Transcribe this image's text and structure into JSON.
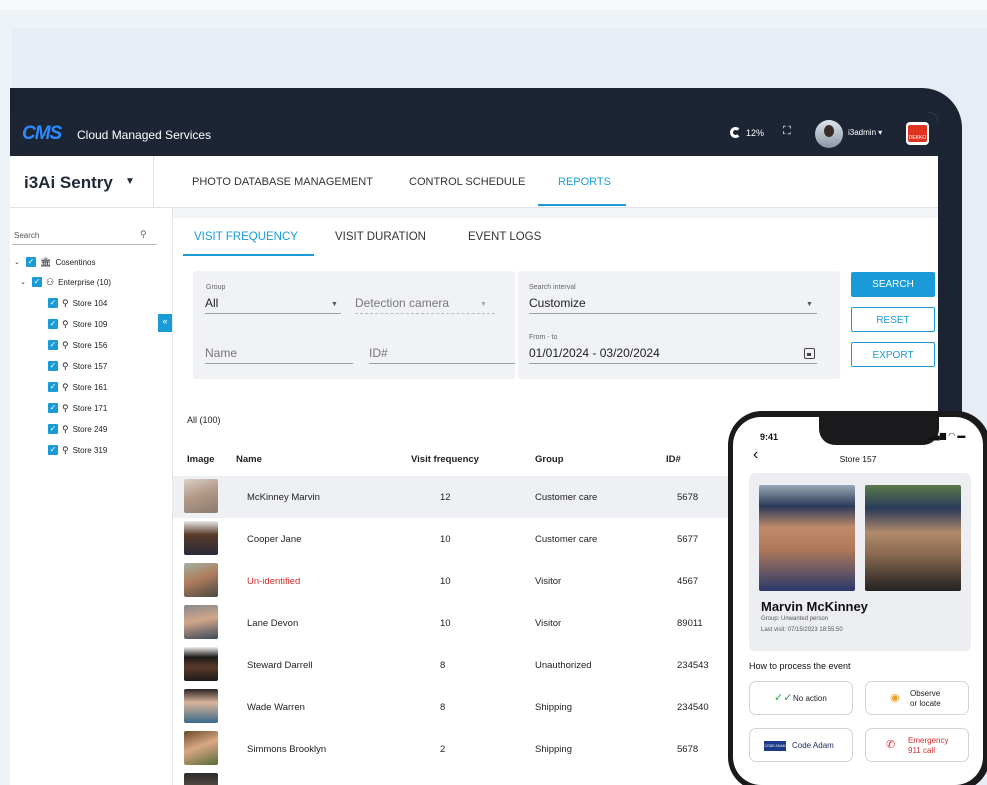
{
  "header": {
    "logo": "CMS",
    "title": "Cloud Managed Services",
    "cpu": "12%",
    "username": "i3admin",
    "partner_logo": "DEKKO"
  },
  "subheader": {
    "brand": "i3Ai Sentry",
    "nav": [
      {
        "label": "PHOTO DATABASE MANAGEMENT",
        "active": false
      },
      {
        "label": "CONTROL SCHEDULE",
        "active": false
      },
      {
        "label": "REPORTS",
        "active": true
      }
    ]
  },
  "sidebar": {
    "search_label": "Search",
    "collapse_glyph": "«",
    "tree": [
      {
        "label": "Cosentinos",
        "icon": "bank-icon",
        "level": 0
      },
      {
        "label": "Enterprise (10)",
        "icon": "enterprise-icon",
        "level": 1
      },
      {
        "label": "Store 104",
        "icon": "store-pin-icon",
        "level": 2
      },
      {
        "label": "Store 109",
        "icon": "store-pin-icon",
        "level": 2
      },
      {
        "label": "Store 156",
        "icon": "store-pin-icon",
        "level": 2
      },
      {
        "label": "Store 157",
        "icon": "store-pin-icon",
        "level": 2
      },
      {
        "label": "Store 161",
        "icon": "store-pin-icon",
        "level": 2
      },
      {
        "label": "Store 171",
        "icon": "store-pin-icon",
        "level": 2
      },
      {
        "label": "Store 249",
        "icon": "store-pin-icon",
        "level": 2
      },
      {
        "label": "Store 319",
        "icon": "store-pin-icon",
        "level": 2
      }
    ]
  },
  "report_tabs": [
    {
      "label": "VISIT FREQUENCY",
      "active": true
    },
    {
      "label": "VISIT DURATION",
      "active": false
    },
    {
      "label": "EVENT LOGS",
      "active": false
    }
  ],
  "filters": {
    "group_label": "Group",
    "group_value": "All",
    "camera_placeholder": "Detection camera",
    "name_placeholder": "Name",
    "id_placeholder": "ID#",
    "interval_label": "Search interval",
    "interval_value": "Customize",
    "range_label": "From - to",
    "range_value": "01/01/2024 - 03/20/2024",
    "search_button": "SEARCH",
    "reset_button": "RESET",
    "export_button": "EXPORT"
  },
  "table": {
    "count": "All (100)",
    "columns": [
      "Image",
      "Name",
      "Visit frequency",
      "Group",
      "ID#"
    ],
    "rows": [
      {
        "name": "McKinney Marvin",
        "freq": "12",
        "group": "Customer care",
        "id": "5678",
        "selected": true,
        "unidentified": false
      },
      {
        "name": "Cooper Jane",
        "freq": "10",
        "group": "Customer care",
        "id": "5677",
        "selected": false,
        "unidentified": false
      },
      {
        "name": "Un-identified",
        "freq": "10",
        "group": "Visitor",
        "id": "4567",
        "selected": false,
        "unidentified": true
      },
      {
        "name": "Lane Devon",
        "freq": "10",
        "group": "Visitor",
        "id": "89011",
        "selected": false,
        "unidentified": false
      },
      {
        "name": "Steward Darrell",
        "freq": "8",
        "group": "Unauthorized",
        "id": "234543",
        "selected": false,
        "unidentified": false
      },
      {
        "name": "Wade Warren",
        "freq": "8",
        "group": "Shipping",
        "id": "234540",
        "selected": false,
        "unidentified": false
      },
      {
        "name": "Simmons Brooklyn",
        "freq": "2",
        "group": "Shipping",
        "id": "5678",
        "selected": false,
        "unidentified": false
      }
    ]
  },
  "phone": {
    "time": "9:41",
    "title": "Store 157",
    "person_name": "Marvin McKinney",
    "group_line": "Group: Unwanted person",
    "last_visit": "Last visit: 07/15/2023 18:55:50",
    "section": "How to process the event",
    "actions": {
      "no_action": "No action",
      "observe_1": "Observe",
      "observe_2": "or locate",
      "code_adam": "Code Adam",
      "code_adam_badge": "CODE ADAM",
      "emergency_1": "Emergency",
      "emergency_2": "911 call"
    }
  },
  "colors": {
    "accent": "#1a9bd7",
    "header_bg": "#1d2535",
    "alert_red": "#d32f2f"
  }
}
